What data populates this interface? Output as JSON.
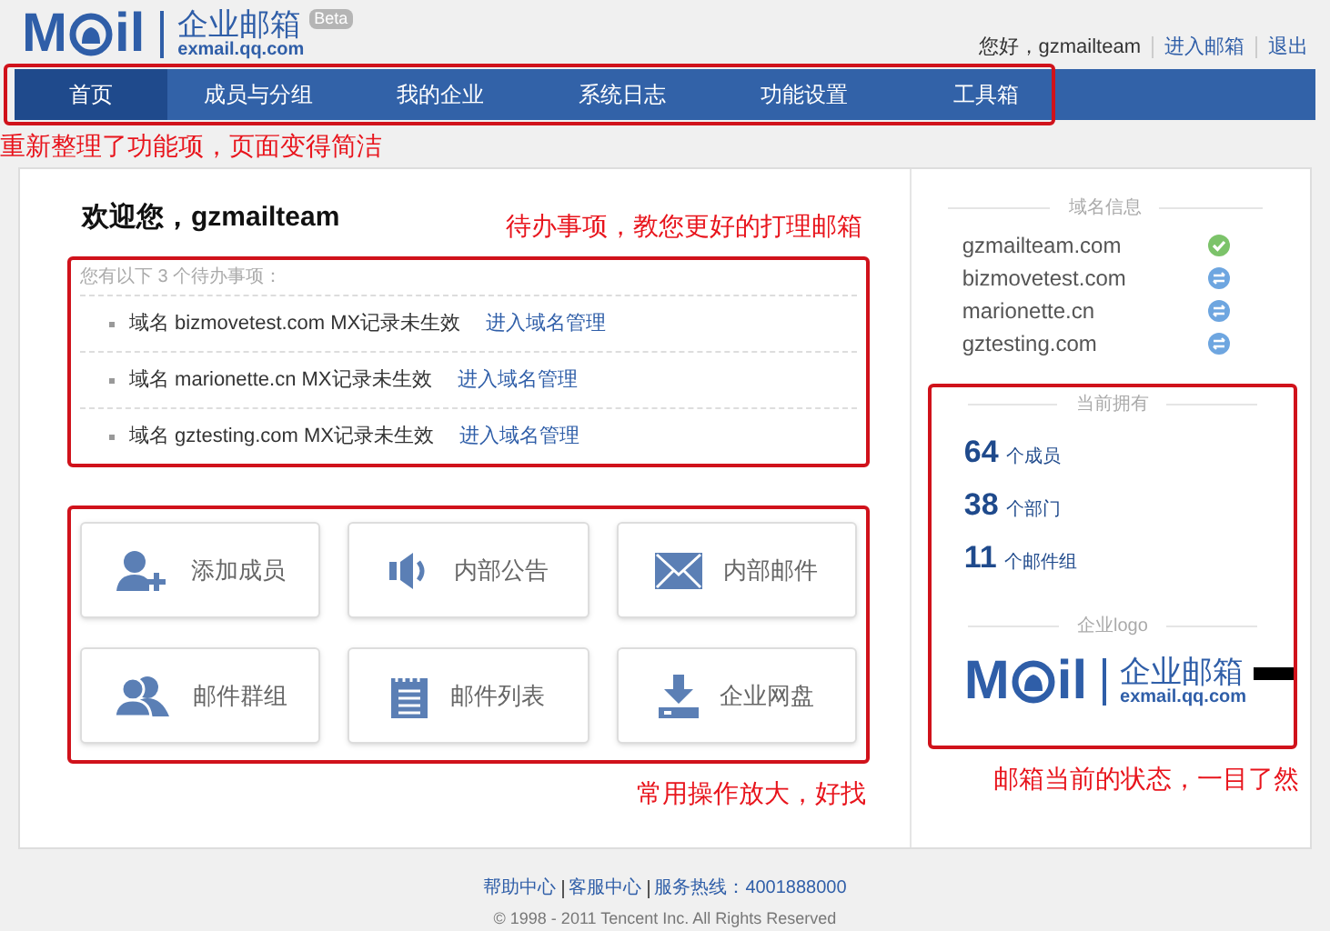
{
  "header": {
    "logo": {
      "left": "M",
      "right": "il",
      "name": "企业邮箱",
      "badge": "Beta",
      "domain": "exmail.qq.com"
    },
    "greeting": "您好，gzmailteam",
    "links": [
      "进入邮箱",
      "退出"
    ]
  },
  "tabs": [
    {
      "label": "首页",
      "selected": true
    },
    {
      "label": "成员与分组",
      "selected": false
    },
    {
      "label": "我的企业",
      "selected": false
    },
    {
      "label": "系统日志",
      "selected": false
    },
    {
      "label": "功能设置",
      "selected": false
    },
    {
      "label": "工具箱",
      "selected": false
    }
  ],
  "annotations": [
    "重新整理了功能项，页面变得简洁",
    "待办事项，教您更好的打理邮箱",
    "常用操作放大，好找",
    "邮箱当前的状态，一目了然"
  ],
  "welcome": "欢迎您，gzmailteam",
  "todo": {
    "intro": "您有以下 3 个待办事项：",
    "items": [
      {
        "text": "域名 bizmovetest.com MX记录未生效",
        "link": "进入域名管理"
      },
      {
        "text": "域名 marionette.cn MX记录未生效",
        "link": "进入域名管理"
      },
      {
        "text": "域名 gztesting.com MX记录未生效",
        "link": "进入域名管理"
      }
    ]
  },
  "actions": [
    {
      "kind": "add-member",
      "label": "添加成员"
    },
    {
      "kind": "notice",
      "label": "内部公告"
    },
    {
      "kind": "mail",
      "label": "内部邮件"
    },
    {
      "kind": "group",
      "label": "邮件群组"
    },
    {
      "kind": "list",
      "label": "邮件列表"
    },
    {
      "kind": "disk",
      "label": "企业网盘"
    }
  ],
  "domains": {
    "title": "域名信息",
    "items": [
      {
        "name": "gzmailteam.com",
        "verified": true
      },
      {
        "name": "bizmovetest.com",
        "verified": false
      },
      {
        "name": "marionette.cn",
        "verified": false
      },
      {
        "name": "gztesting.com",
        "verified": false
      }
    ]
  },
  "stats": {
    "title": "当前拥有",
    "items": [
      {
        "value": "64",
        "unit": "个成员"
      },
      {
        "value": "38",
        "unit": "个部门"
      },
      {
        "value": "11",
        "unit": "个邮件组"
      }
    ]
  },
  "company_logo": {
    "title": "企业logo",
    "left": "M",
    "right": "il",
    "name": "企业邮箱",
    "domain": "exmail.qq.com"
  },
  "footer": {
    "links": [
      "帮助中心",
      "客服中心",
      "服务热线：4001888000"
    ],
    "copyright": "© 1998 - 2011 Tencent Inc. All Rights Reserved"
  }
}
